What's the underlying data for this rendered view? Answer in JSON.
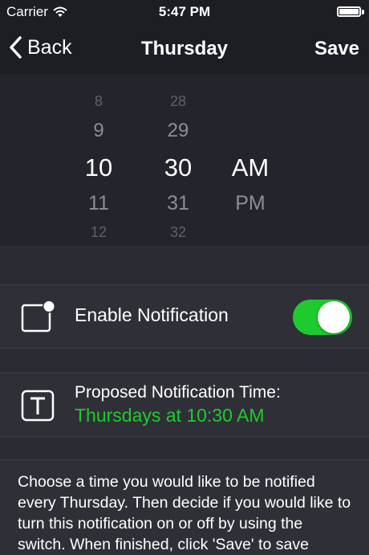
{
  "status_bar": {
    "carrier": "Carrier",
    "time": "5:47 PM",
    "battery_level": 1.0
  },
  "nav": {
    "back_label": "Back",
    "title": "Thursday",
    "save_label": "Save"
  },
  "picker": {
    "hours": [
      "8",
      "9",
      "10",
      "11",
      "12"
    ],
    "minutes": [
      "28",
      "29",
      "30",
      "31",
      "32"
    ],
    "periods": [
      "",
      "",
      "AM",
      "PM",
      ""
    ],
    "selected": {
      "hour": "10",
      "minute": "30",
      "period": "AM"
    }
  },
  "enable_notification": {
    "label": "Enable Notification",
    "toggle_on": true,
    "icon": "notification-badge-icon"
  },
  "proposed": {
    "label": "Proposed Notification Time:",
    "value": "Thursdays at 10:30 AM",
    "icon": "text-t-icon"
  },
  "help": {
    "text": "Choose a time you would like to be notified every Thursday. Then decide if you would like to turn this notification on or off by using the switch. When finished, click 'Save' to save"
  },
  "colors": {
    "accent_green": "#1ecb2e",
    "background": "#2b2c33",
    "bar": "#1d1e24"
  }
}
